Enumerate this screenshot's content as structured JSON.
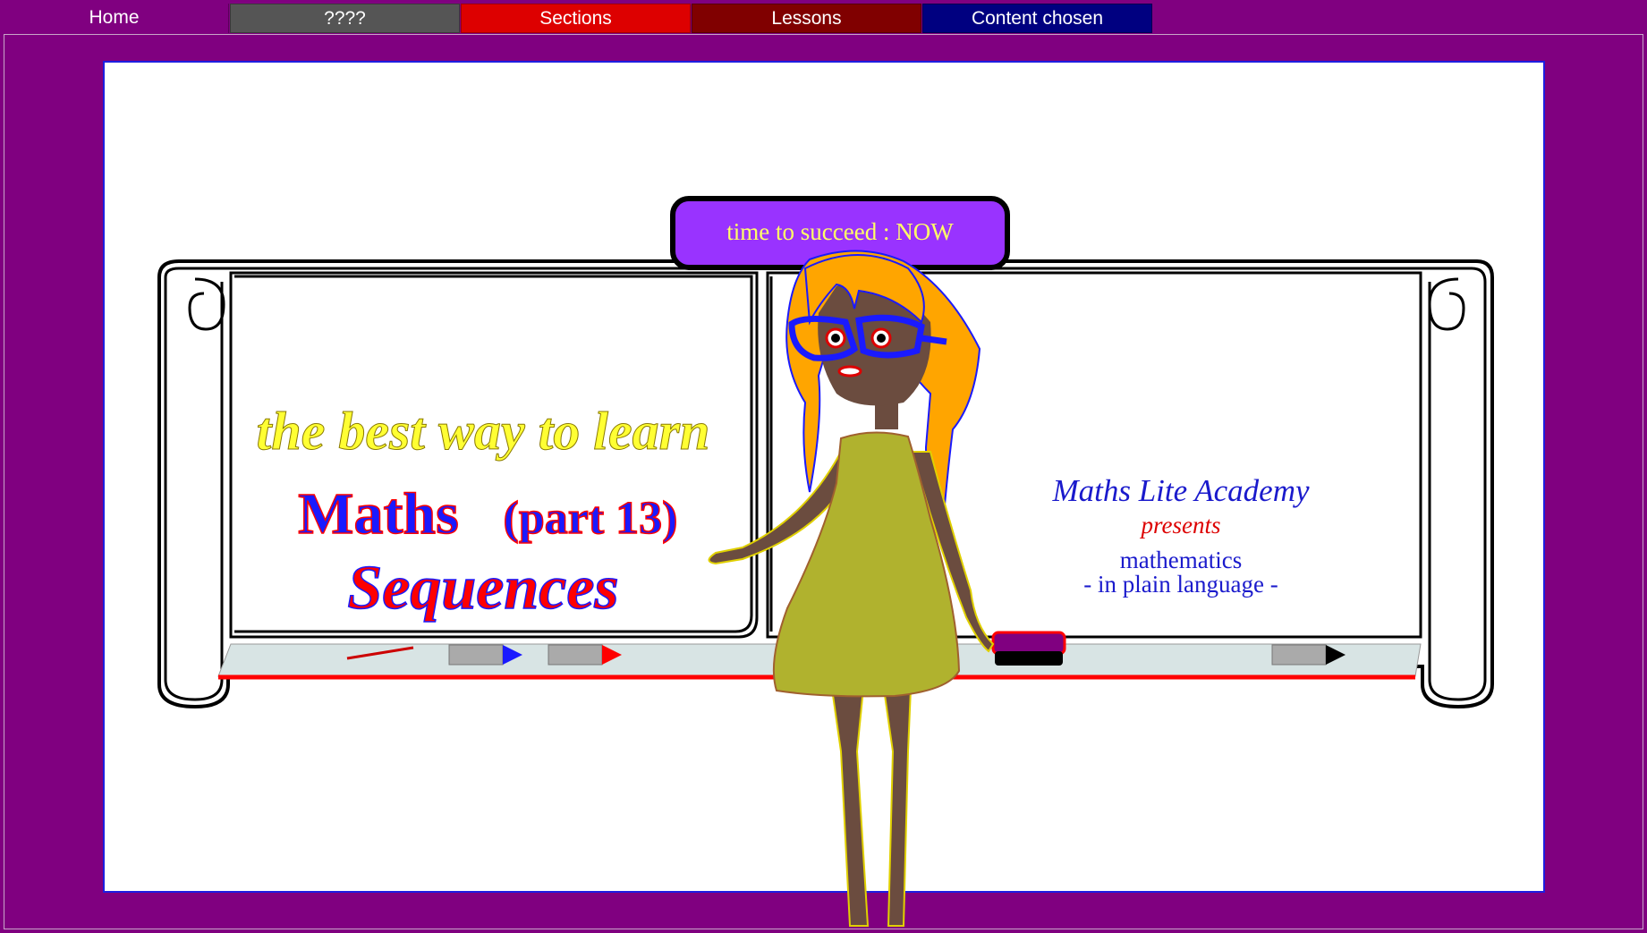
{
  "nav": {
    "home": "Home",
    "unknown": "????",
    "sections": "Sections",
    "lessons": "Lessons",
    "content": "Content chosen"
  },
  "banner": "time to succeed : NOW",
  "left_board": {
    "tagline": "the best way to learn",
    "subject": "Maths",
    "part": "(part 13)",
    "topic": "Sequences"
  },
  "right_board": {
    "academy": "Maths Lite Academy",
    "presents": "presents",
    "line1": "mathematics",
    "line2": "- in plain language -"
  },
  "colors": {
    "background": "#800080",
    "banner": "#9933ff",
    "accent_blue": "#1a1aff",
    "accent_red": "#dd0000",
    "accent_yellow": "#ffff33"
  }
}
